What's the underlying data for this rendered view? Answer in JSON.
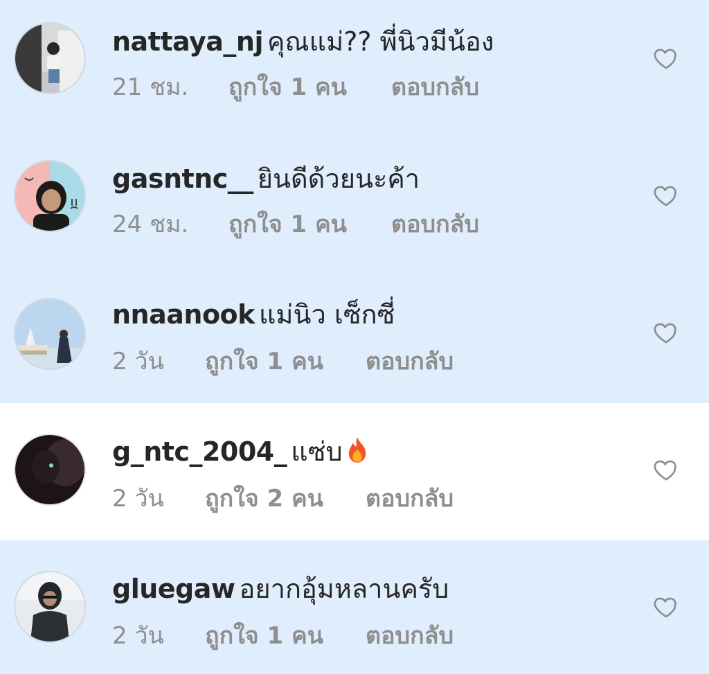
{
  "comments": [
    {
      "username": "nattaya_nj",
      "text": "คุณแม่?? พี่นิวมีน้อง",
      "time": "21 ชม.",
      "likes": "ถูกใจ 1 คน",
      "reply": "ตอบกลับ",
      "highlighted": true,
      "avatar_icon": "avatar-photo-selfie"
    },
    {
      "username": "gasntnc__",
      "text": "ยินดีด้วยนะค้า",
      "time": "24 ชม.",
      "likes": "ถูกใจ 1 คน",
      "reply": "ตอบกลับ",
      "highlighted": true,
      "avatar_icon": "avatar-photo-girl"
    },
    {
      "username": "nnaanook",
      "text": "แม่นิว เซ็กซี่",
      "time": "2 วัน",
      "likes": "ถูกใจ 1 คน",
      "reply": "ตอบกลับ",
      "highlighted": true,
      "avatar_icon": "avatar-photo-landmark"
    },
    {
      "username": "g_ntc_2004_",
      "text": "แซ่บ",
      "emoji": "fire-emoji",
      "time": "2 วัน",
      "likes": "ถูกใจ 2 คน",
      "reply": "ตอบกลับ",
      "highlighted": false,
      "avatar_icon": "avatar-photo-dark"
    },
    {
      "username": "gluegaw",
      "text": "อยากอุ้มหลานครับ",
      "time": "2 วัน",
      "likes": "ถูกใจ 1 คน",
      "reply": "ตอบกลับ",
      "highlighted": true,
      "avatar_icon": "avatar-photo-jacket"
    }
  ],
  "colors": {
    "highlight_bg": "#e0edfc",
    "username": "#262626",
    "meta": "#8e8e8e",
    "heart_outline": "#8e8e8e"
  },
  "icons": {
    "like": "heart-outline-icon"
  }
}
